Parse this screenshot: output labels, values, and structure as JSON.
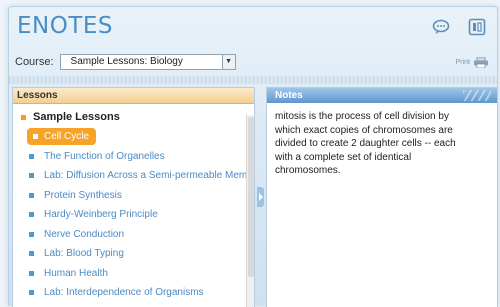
{
  "app": {
    "title": "ENOTES"
  },
  "toolbar": {
    "chat_icon": "speech-bubble-icon",
    "export_icon": "export-window-icon"
  },
  "course": {
    "label": "Course:",
    "selected": "Sample Lessons: Biology"
  },
  "print": {
    "label": "Print",
    "icon": "printer-icon"
  },
  "lessons": {
    "header": "Lessons",
    "group": "Sample Lessons",
    "items": [
      {
        "label": "Cell Cycle",
        "selected": true
      },
      {
        "label": "The Function of Organelles"
      },
      {
        "label": "Lab: Diffusion Across a Semi-permeable Membrane"
      },
      {
        "label": "Protein Synthesis"
      },
      {
        "label": "Hardy-Weinberg Principle"
      },
      {
        "label": "Nerve Conduction"
      },
      {
        "label": "Lab: Blood Typing"
      },
      {
        "label": "Human Health"
      },
      {
        "label": "Lab: Interdependence of Organisms"
      }
    ]
  },
  "notes": {
    "header": "Notes",
    "text": "mitosis is the process of cell division by which exact copies of chromosomes are divided to create 2 daughter cells -- each with a complete set of identical chromosomes."
  },
  "colors": {
    "accent_orange": "#f7a328",
    "link_blue": "#4b8ac3",
    "title_blue": "#4a8dc6"
  }
}
